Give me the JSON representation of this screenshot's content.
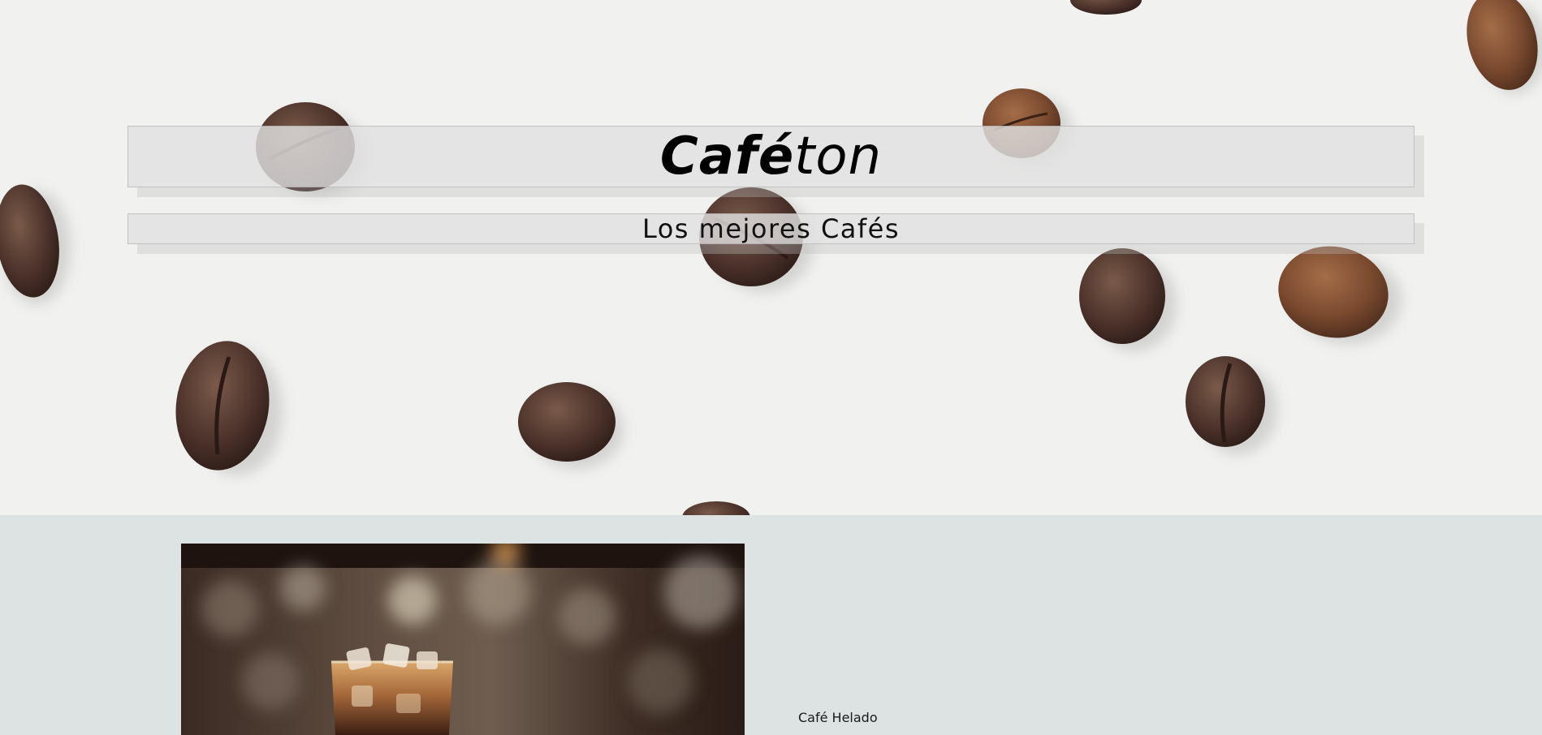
{
  "hero": {
    "brand_bold": "Café",
    "brand_light": "ton",
    "tagline": "Los mejores Cafés"
  },
  "products": [
    {
      "name": "Café Helado"
    }
  ]
}
